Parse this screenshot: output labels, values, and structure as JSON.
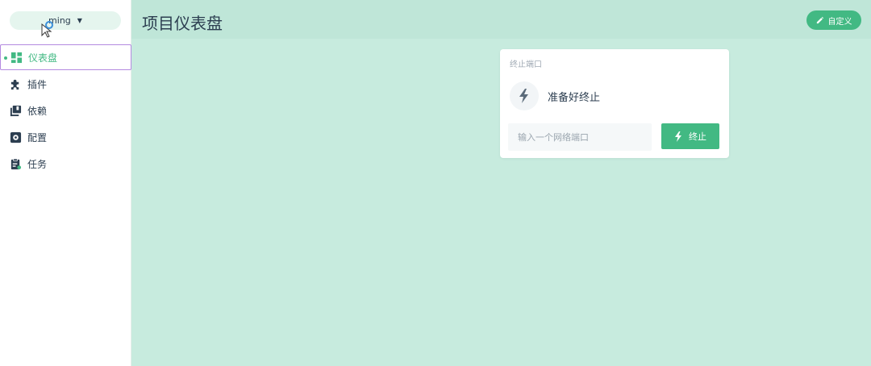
{
  "sidebar": {
    "project_selector": {
      "label": "ming"
    },
    "items": [
      {
        "label": "仪表盘",
        "icon": "dashboard-icon",
        "active": true
      },
      {
        "label": "插件",
        "icon": "puzzle-icon",
        "active": false
      },
      {
        "label": "依赖",
        "icon": "library-icon",
        "active": false
      },
      {
        "label": "配置",
        "icon": "settings-icon",
        "active": false
      },
      {
        "label": "任务",
        "icon": "clipboard-icon",
        "active": false
      }
    ]
  },
  "header": {
    "title": "项目仪表盘",
    "customize_label": "自定义"
  },
  "widget": {
    "title": "终止端口",
    "status_text": "准备好终止",
    "port_input": {
      "value": "",
      "placeholder": "输入一个网络端口"
    },
    "kill_label": "终止"
  },
  "colors": {
    "accent": "#42b983",
    "main_background": "#c7ebde",
    "text": "#2c3e50"
  }
}
